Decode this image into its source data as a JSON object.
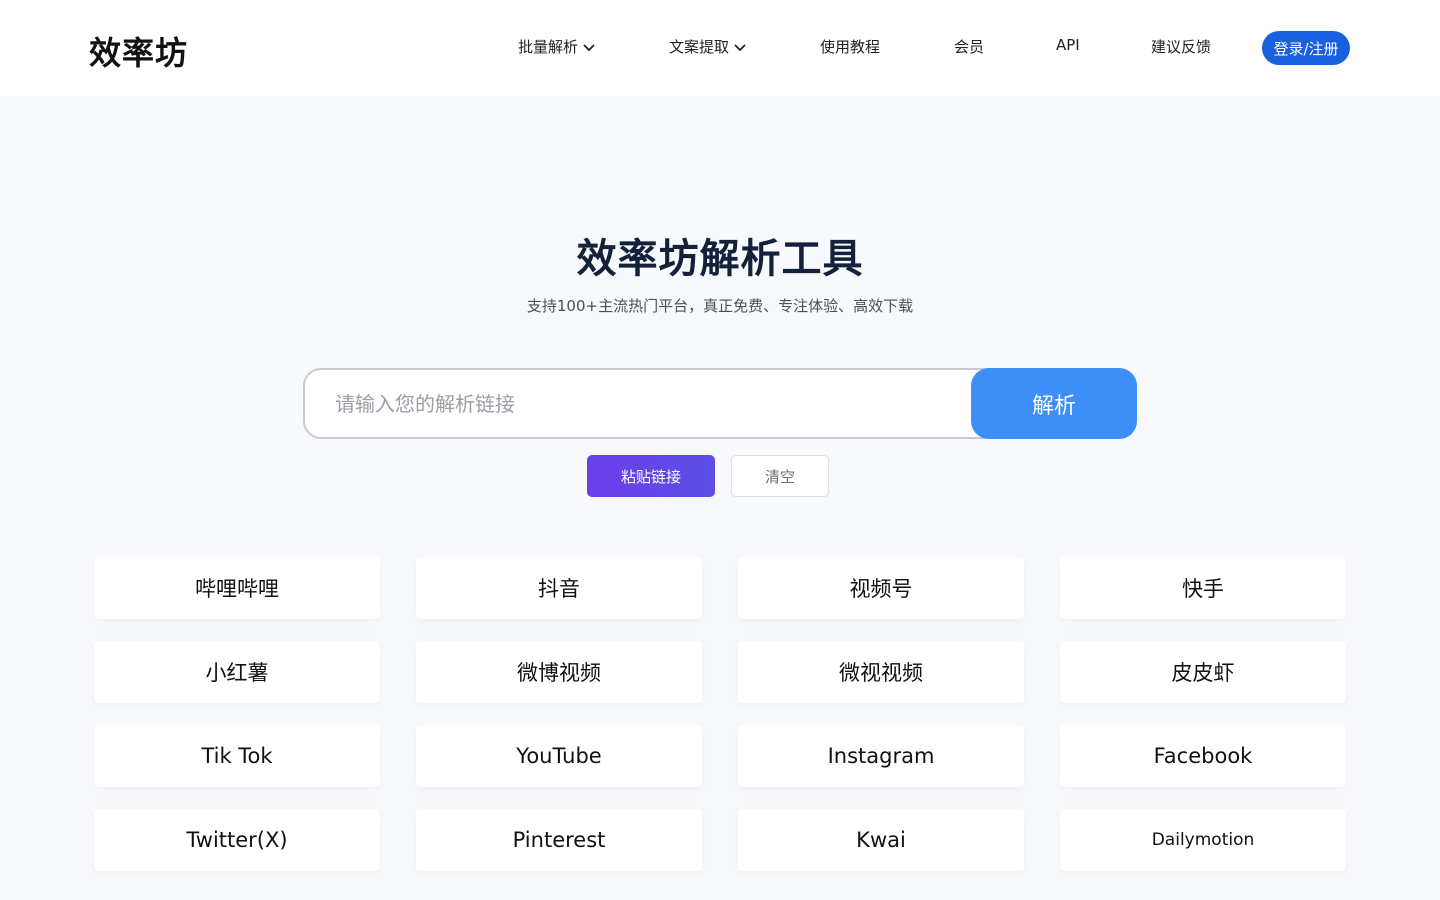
{
  "header": {
    "logo": "效率坊",
    "nav": [
      {
        "label": "批量解析",
        "dropdown": true
      },
      {
        "label": "文案提取",
        "dropdown": true
      },
      {
        "label": "使用教程",
        "dropdown": false
      },
      {
        "label": "会员",
        "dropdown": false
      },
      {
        "label": "API",
        "dropdown": false
      },
      {
        "label": "建议反馈",
        "dropdown": false
      }
    ],
    "login_label": "登录/注册"
  },
  "hero": {
    "title": "效率坊解析工具",
    "subtitle": "支持100+主流热门平台，真正免费、专注体验、高效下载"
  },
  "search": {
    "value": "",
    "placeholder": "请输入您的解析链接",
    "submit_label": "解析"
  },
  "actions": {
    "paste_label": "粘贴链接",
    "clear_label": "清空"
  },
  "platforms": [
    "哔哩哔哩",
    "抖音",
    "视频号",
    "快手",
    "小红薯",
    "微博视频",
    "微视视频",
    "皮皮虾",
    "Tik Tok",
    "YouTube",
    "Instagram",
    "Facebook",
    "Twitter(X)",
    "Pinterest",
    "Kwai",
    "Dailymotion"
  ],
  "colors": {
    "accent": "#1a5fe0",
    "parse_button": "#3d8ef7",
    "paste_button": "#6b3fe8",
    "background": "#f7f9fc"
  }
}
